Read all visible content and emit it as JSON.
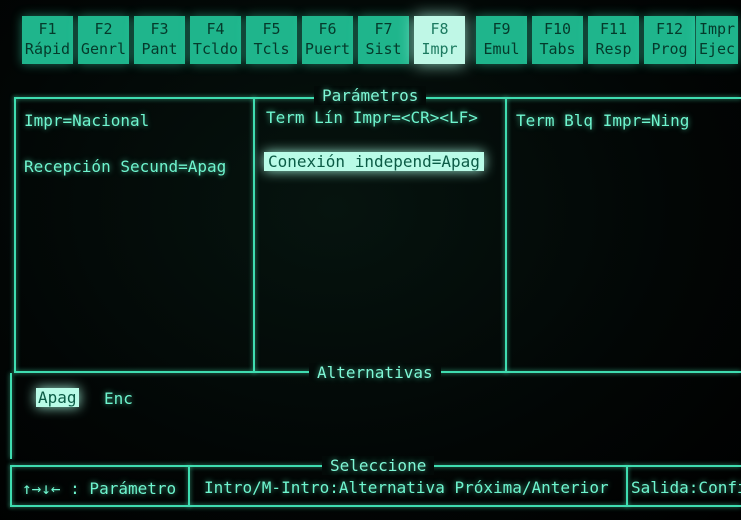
{
  "function_keys": [
    {
      "key": "F1",
      "label": "Rápid"
    },
    {
      "key": "F2",
      "label": "Genrl"
    },
    {
      "key": "F3",
      "label": "Pant"
    },
    {
      "key": "F4",
      "label": "Tcldo"
    },
    {
      "key": "F5",
      "label": "Tcls"
    },
    {
      "key": "F6",
      "label": "Puert"
    },
    {
      "key": "F7",
      "label": "Sist"
    },
    {
      "key": "F8",
      "label": "Impr"
    },
    {
      "key": "F9",
      "label": "Emul"
    },
    {
      "key": "F10",
      "label": "Tabs"
    },
    {
      "key": "F11",
      "label": "Resp"
    },
    {
      "key": "F12",
      "label": "Prog"
    },
    {
      "key": "Impr",
      "label": "Ejec"
    }
  ],
  "parameters": {
    "title": "Parámetros",
    "col1": [
      "Impr=Nacional",
      "Recepción Secund=Apag"
    ],
    "col2": [
      "Term Lín Impr=<CR><LF>",
      "Conexión independ=Apag"
    ],
    "col3": [
      "Term Blq Impr=Ning"
    ]
  },
  "alternatives": {
    "title": "Alternativas",
    "options": [
      "Apag",
      "Enc"
    ]
  },
  "select": {
    "title": "Seleccione",
    "hint1": "↑→↓← : Parámetro",
    "hint2": "Intro/M-Intro:Alternativa Próxima/Anterior",
    "hint3": "Salida:Config"
  }
}
